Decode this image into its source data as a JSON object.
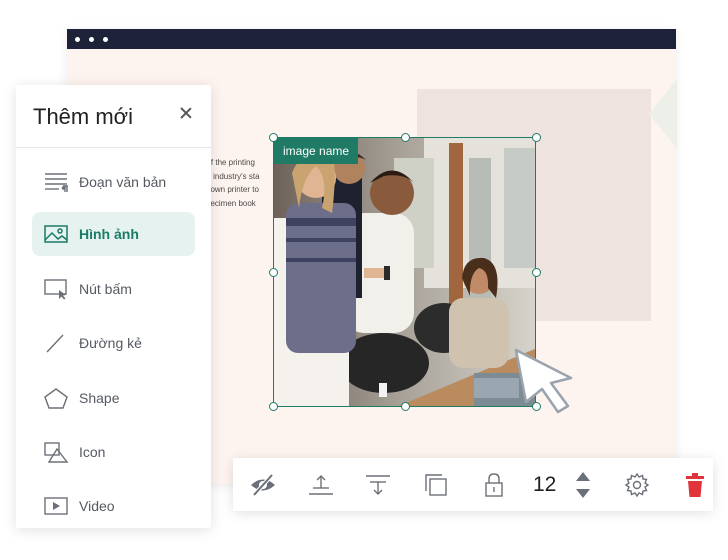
{
  "canvas": {
    "text_lines": [
      "t of the printing",
      "he industry's sta",
      "known printer to",
      "specimen book"
    ]
  },
  "panel": {
    "title": "Thêm mới",
    "items": [
      {
        "label": "Đoạn văn bản",
        "icon": "paragraph-icon"
      },
      {
        "label": "Hình ảnh",
        "icon": "image-icon",
        "active": true
      },
      {
        "label": "Nút bấm",
        "icon": "button-icon"
      },
      {
        "label": "Đường kẻ",
        "icon": "line-icon"
      },
      {
        "label": "Shape",
        "icon": "pentagon-icon"
      },
      {
        "label": "Icon",
        "icon": "icon-shapes-icon"
      },
      {
        "label": "Video",
        "icon": "video-play-icon"
      }
    ]
  },
  "selection": {
    "tag": "image name"
  },
  "toolbar": {
    "value": "12",
    "icons": [
      "hide-eye-icon",
      "align-top-icon",
      "align-bottom-icon",
      "duplicate-icon",
      "lock-icon",
      "stepper-icon",
      "settings-gear-icon",
      "trash-icon"
    ]
  },
  "colors": {
    "accent": "#1f7a66",
    "active_bg": "#e6f2ef",
    "browser_bar": "#1d2238",
    "canvas_bg": "#fdf3ef",
    "delete": "#e0353b"
  }
}
